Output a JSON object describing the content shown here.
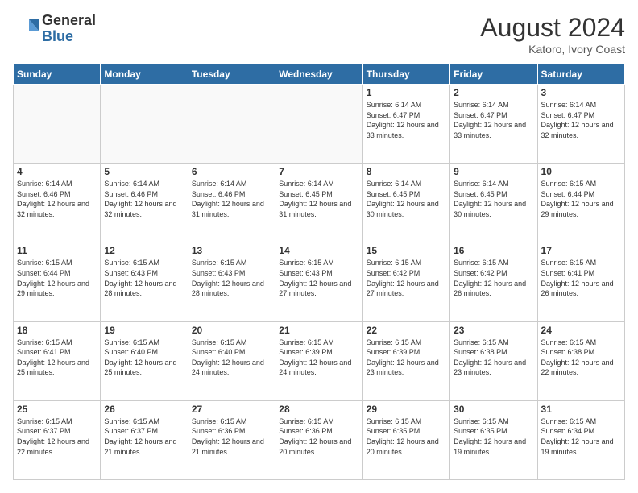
{
  "header": {
    "logo_general": "General",
    "logo_blue": "Blue",
    "month_year": "August 2024",
    "location": "Katoro, Ivory Coast"
  },
  "days_of_week": [
    "Sunday",
    "Monday",
    "Tuesday",
    "Wednesday",
    "Thursday",
    "Friday",
    "Saturday"
  ],
  "weeks": [
    [
      {
        "day": "",
        "sunrise": "",
        "sunset": "",
        "daylight": ""
      },
      {
        "day": "",
        "sunrise": "",
        "sunset": "",
        "daylight": ""
      },
      {
        "day": "",
        "sunrise": "",
        "sunset": "",
        "daylight": ""
      },
      {
        "day": "",
        "sunrise": "",
        "sunset": "",
        "daylight": ""
      },
      {
        "day": "1",
        "sunrise": "Sunrise: 6:14 AM",
        "sunset": "Sunset: 6:47 PM",
        "daylight": "Daylight: 12 hours and 33 minutes."
      },
      {
        "day": "2",
        "sunrise": "Sunrise: 6:14 AM",
        "sunset": "Sunset: 6:47 PM",
        "daylight": "Daylight: 12 hours and 33 minutes."
      },
      {
        "day": "3",
        "sunrise": "Sunrise: 6:14 AM",
        "sunset": "Sunset: 6:47 PM",
        "daylight": "Daylight: 12 hours and 32 minutes."
      }
    ],
    [
      {
        "day": "4",
        "sunrise": "Sunrise: 6:14 AM",
        "sunset": "Sunset: 6:46 PM",
        "daylight": "Daylight: 12 hours and 32 minutes."
      },
      {
        "day": "5",
        "sunrise": "Sunrise: 6:14 AM",
        "sunset": "Sunset: 6:46 PM",
        "daylight": "Daylight: 12 hours and 32 minutes."
      },
      {
        "day": "6",
        "sunrise": "Sunrise: 6:14 AM",
        "sunset": "Sunset: 6:46 PM",
        "daylight": "Daylight: 12 hours and 31 minutes."
      },
      {
        "day": "7",
        "sunrise": "Sunrise: 6:14 AM",
        "sunset": "Sunset: 6:45 PM",
        "daylight": "Daylight: 12 hours and 31 minutes."
      },
      {
        "day": "8",
        "sunrise": "Sunrise: 6:14 AM",
        "sunset": "Sunset: 6:45 PM",
        "daylight": "Daylight: 12 hours and 30 minutes."
      },
      {
        "day": "9",
        "sunrise": "Sunrise: 6:14 AM",
        "sunset": "Sunset: 6:45 PM",
        "daylight": "Daylight: 12 hours and 30 minutes."
      },
      {
        "day": "10",
        "sunrise": "Sunrise: 6:15 AM",
        "sunset": "Sunset: 6:44 PM",
        "daylight": "Daylight: 12 hours and 29 minutes."
      }
    ],
    [
      {
        "day": "11",
        "sunrise": "Sunrise: 6:15 AM",
        "sunset": "Sunset: 6:44 PM",
        "daylight": "Daylight: 12 hours and 29 minutes."
      },
      {
        "day": "12",
        "sunrise": "Sunrise: 6:15 AM",
        "sunset": "Sunset: 6:43 PM",
        "daylight": "Daylight: 12 hours and 28 minutes."
      },
      {
        "day": "13",
        "sunrise": "Sunrise: 6:15 AM",
        "sunset": "Sunset: 6:43 PM",
        "daylight": "Daylight: 12 hours and 28 minutes."
      },
      {
        "day": "14",
        "sunrise": "Sunrise: 6:15 AM",
        "sunset": "Sunset: 6:43 PM",
        "daylight": "Daylight: 12 hours and 27 minutes."
      },
      {
        "day": "15",
        "sunrise": "Sunrise: 6:15 AM",
        "sunset": "Sunset: 6:42 PM",
        "daylight": "Daylight: 12 hours and 27 minutes."
      },
      {
        "day": "16",
        "sunrise": "Sunrise: 6:15 AM",
        "sunset": "Sunset: 6:42 PM",
        "daylight": "Daylight: 12 hours and 26 minutes."
      },
      {
        "day": "17",
        "sunrise": "Sunrise: 6:15 AM",
        "sunset": "Sunset: 6:41 PM",
        "daylight": "Daylight: 12 hours and 26 minutes."
      }
    ],
    [
      {
        "day": "18",
        "sunrise": "Sunrise: 6:15 AM",
        "sunset": "Sunset: 6:41 PM",
        "daylight": "Daylight: 12 hours and 25 minutes."
      },
      {
        "day": "19",
        "sunrise": "Sunrise: 6:15 AM",
        "sunset": "Sunset: 6:40 PM",
        "daylight": "Daylight: 12 hours and 25 minutes."
      },
      {
        "day": "20",
        "sunrise": "Sunrise: 6:15 AM",
        "sunset": "Sunset: 6:40 PM",
        "daylight": "Daylight: 12 hours and 24 minutes."
      },
      {
        "day": "21",
        "sunrise": "Sunrise: 6:15 AM",
        "sunset": "Sunset: 6:39 PM",
        "daylight": "Daylight: 12 hours and 24 minutes."
      },
      {
        "day": "22",
        "sunrise": "Sunrise: 6:15 AM",
        "sunset": "Sunset: 6:39 PM",
        "daylight": "Daylight: 12 hours and 23 minutes."
      },
      {
        "day": "23",
        "sunrise": "Sunrise: 6:15 AM",
        "sunset": "Sunset: 6:38 PM",
        "daylight": "Daylight: 12 hours and 23 minutes."
      },
      {
        "day": "24",
        "sunrise": "Sunrise: 6:15 AM",
        "sunset": "Sunset: 6:38 PM",
        "daylight": "Daylight: 12 hours and 22 minutes."
      }
    ],
    [
      {
        "day": "25",
        "sunrise": "Sunrise: 6:15 AM",
        "sunset": "Sunset: 6:37 PM",
        "daylight": "Daylight: 12 hours and 22 minutes."
      },
      {
        "day": "26",
        "sunrise": "Sunrise: 6:15 AM",
        "sunset": "Sunset: 6:37 PM",
        "daylight": "Daylight: 12 hours and 21 minutes."
      },
      {
        "day": "27",
        "sunrise": "Sunrise: 6:15 AM",
        "sunset": "Sunset: 6:36 PM",
        "daylight": "Daylight: 12 hours and 21 minutes."
      },
      {
        "day": "28",
        "sunrise": "Sunrise: 6:15 AM",
        "sunset": "Sunset: 6:36 PM",
        "daylight": "Daylight: 12 hours and 20 minutes."
      },
      {
        "day": "29",
        "sunrise": "Sunrise: 6:15 AM",
        "sunset": "Sunset: 6:35 PM",
        "daylight": "Daylight: 12 hours and 20 minutes."
      },
      {
        "day": "30",
        "sunrise": "Sunrise: 6:15 AM",
        "sunset": "Sunset: 6:35 PM",
        "daylight": "Daylight: 12 hours and 19 minutes."
      },
      {
        "day": "31",
        "sunrise": "Sunrise: 6:15 AM",
        "sunset": "Sunset: 6:34 PM",
        "daylight": "Daylight: 12 hours and 19 minutes."
      }
    ]
  ]
}
